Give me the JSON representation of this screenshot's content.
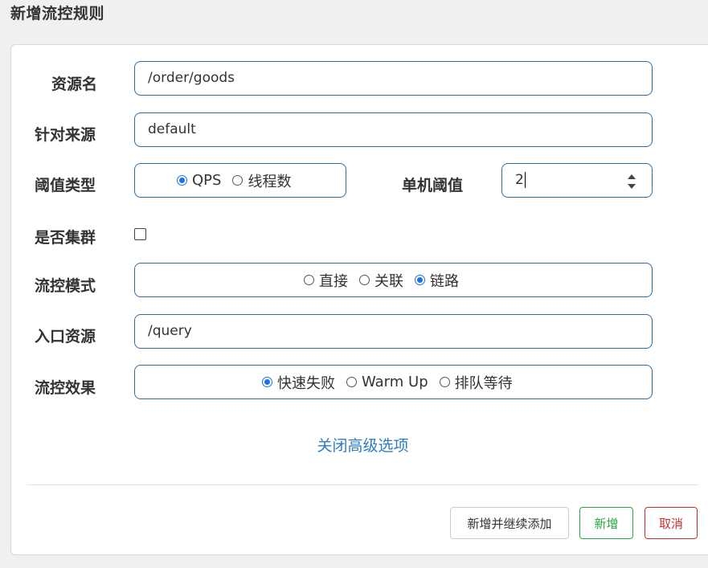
{
  "dialog": {
    "title": "新增流控规则"
  },
  "form": {
    "resource": {
      "label": "资源名",
      "value": "/order/goods"
    },
    "origin": {
      "label": "针对来源",
      "value": "default"
    },
    "threshold_type": {
      "label": "阈值类型",
      "options": [
        "QPS",
        "线程数"
      ],
      "selected": "QPS"
    },
    "threshold": {
      "label": "单机阈值",
      "value": "2"
    },
    "cluster": {
      "label": "是否集群",
      "checked": false
    },
    "control_mode": {
      "label": "流控模式",
      "options": [
        "直接",
        "关联",
        "链路"
      ],
      "selected": "链路"
    },
    "entry_resource": {
      "label": "入口资源",
      "value": "/query"
    },
    "control_effect": {
      "label": "流控效果",
      "options": [
        "快速失败",
        "Warm Up",
        "排队等待"
      ],
      "selected": "快速失败"
    },
    "toggle_advanced": "关闭高级选项"
  },
  "footer": {
    "add_continue": "新增并继续添加",
    "add": "新增",
    "cancel": "取消"
  },
  "colors": {
    "accent": "#1a73e8",
    "field_border": "#2e6da4",
    "link": "#2d7bc4",
    "add_green": "#28a745",
    "cancel_red": "#c9302c"
  }
}
